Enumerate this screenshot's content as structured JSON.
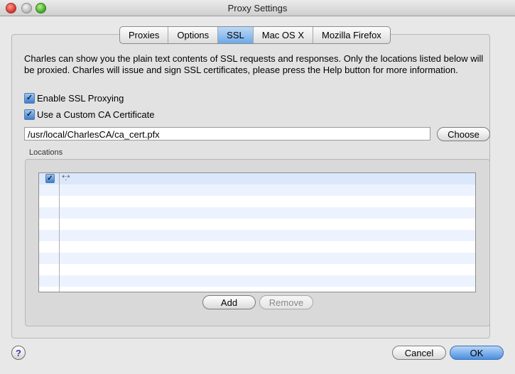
{
  "window": {
    "title": "Proxy Settings"
  },
  "tabs": [
    {
      "label": "Proxies"
    },
    {
      "label": "Options"
    },
    {
      "label": "SSL",
      "active": true
    },
    {
      "label": "Mac OS X"
    },
    {
      "label": "Mozilla Firefox"
    }
  ],
  "ssl": {
    "description": "Charles can show you the plain text contents of SSL requests and responses. Only the locations listed below will be proxied. Charles will issue and sign SSL certificates, please press the Help button for more information.",
    "enable_ssl_label": "Enable SSL Proxying",
    "enable_ssl_checked": true,
    "custom_ca_label": "Use a Custom CA Certificate",
    "custom_ca_checked": true,
    "ca_path": "/usr/local/CharlesCA/ca_cert.pfx",
    "choose_label": "Choose"
  },
  "locations": {
    "label": "Locations",
    "rows": [
      {
        "enabled": true,
        "location": "*:*"
      }
    ],
    "add_label": "Add",
    "remove_label": "Remove"
  },
  "footer": {
    "help_label": "?",
    "cancel_label": "Cancel",
    "ok_label": "OK"
  },
  "colors": {
    "accent": "#6ea9e8",
    "row_alt": "#edf3fe"
  },
  "icons": {
    "help": "question-icon",
    "check": "checkmark-icon"
  }
}
